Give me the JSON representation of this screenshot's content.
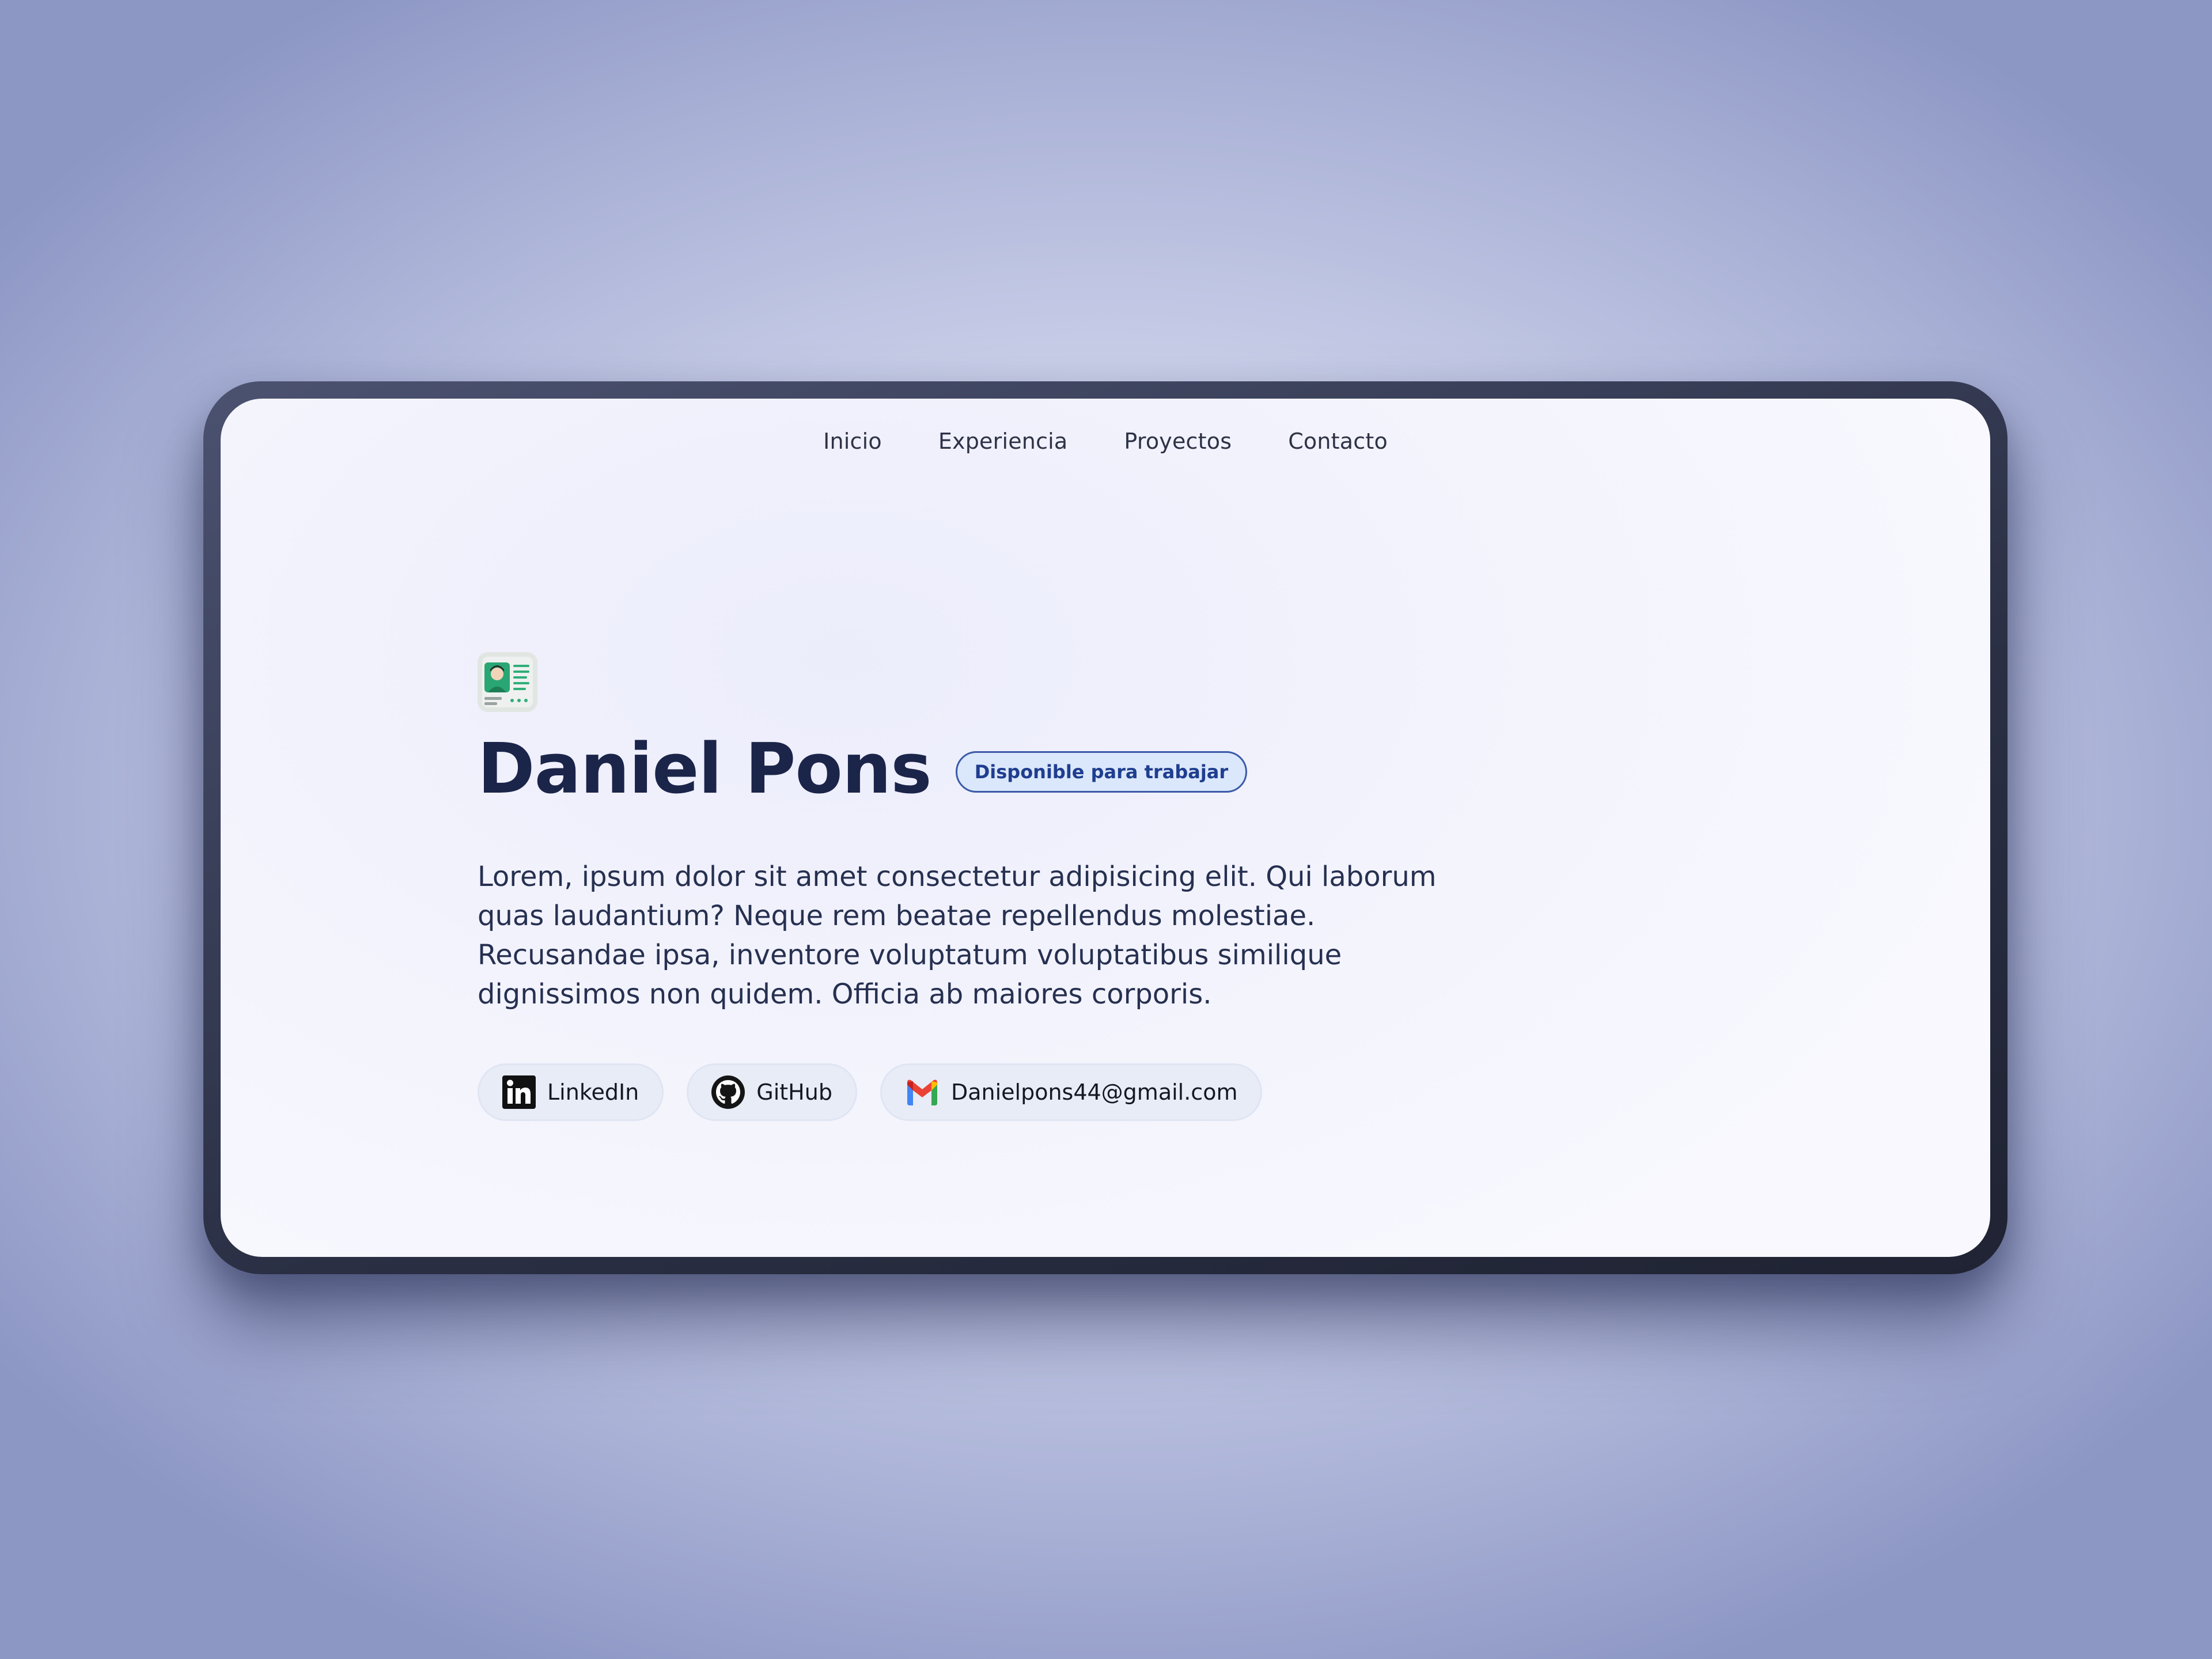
{
  "nav": {
    "items": [
      {
        "label": "Inicio"
      },
      {
        "label": "Experiencia"
      },
      {
        "label": "Proyectos"
      },
      {
        "label": "Contacto"
      }
    ]
  },
  "hero": {
    "avatar_icon": "profile-card-icon",
    "name": "Daniel Pons",
    "badge": "Disponible para trabajar",
    "description": "Lorem, ipsum dolor sit amet consectetur adipisicing elit. Qui laborum quas laudantium? Neque rem beatae repellendus molestiae. Recusandae ipsa, inventore voluptatum voluptatibus similique dignissimos non quidem. Officia ab maiores corporis."
  },
  "links": [
    {
      "label": "LinkedIn",
      "icon": "linkedin-icon"
    },
    {
      "label": "GitHub",
      "icon": "github-icon"
    },
    {
      "label": "Danielpons44@gmail.com",
      "icon": "gmail-icon"
    }
  ],
  "colors": {
    "title": "#1b2449",
    "badge_border": "#3b5aa8",
    "badge_bg": "#dbe7fb",
    "badge_text": "#1f3e8f"
  }
}
